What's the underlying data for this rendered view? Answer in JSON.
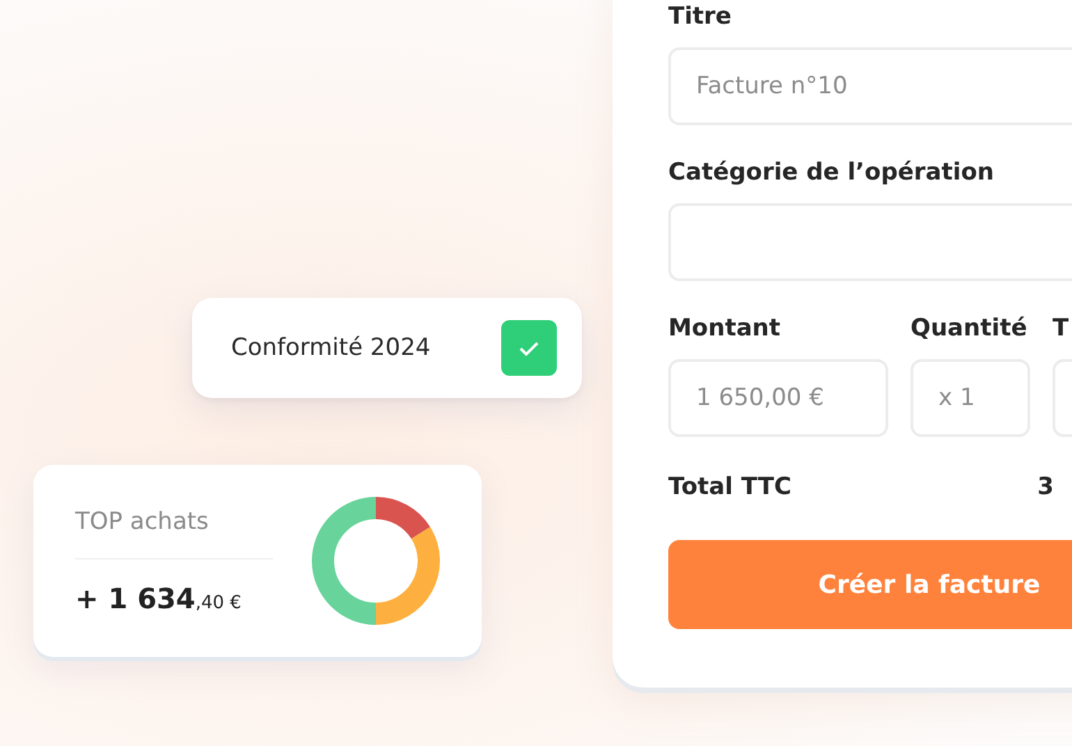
{
  "compliance_card": {
    "label": "Conformité 2024",
    "checked": true
  },
  "purchases_card": {
    "title": "TOP achats",
    "amount_main": "+ 1 634",
    "amount_cents": ",40 €"
  },
  "invoice_form": {
    "title_label": "Titre",
    "title_placeholder": "Facture n°10",
    "category_label": "Catégorie de l’opération",
    "columns": [
      {
        "label": "Montant",
        "placeholder": "1 650,00 €",
        "kind": "wide"
      },
      {
        "label": "Quantité",
        "placeholder": "x 1",
        "kind": "narrow"
      },
      {
        "label": "T",
        "kind": "cut"
      }
    ],
    "total_label": "Total TTC",
    "total_value": "3",
    "submit": "Créer la facture"
  }
}
